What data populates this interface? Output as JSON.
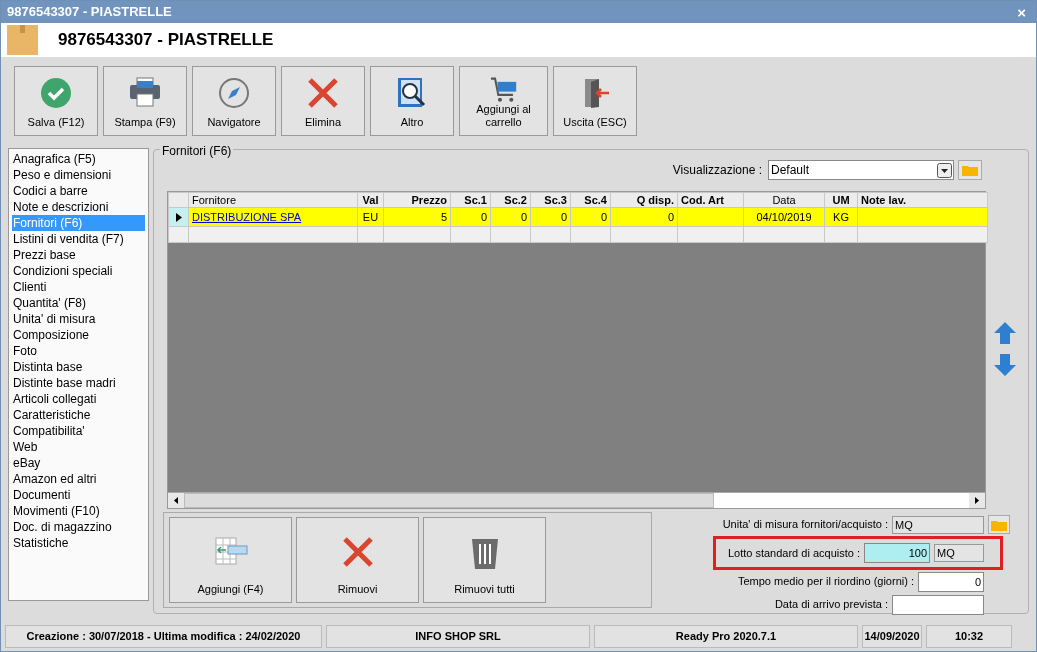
{
  "window": {
    "title": "9876543307 - PIASTRELLE",
    "close": "×"
  },
  "header": {
    "title": "9876543307 - PIASTRELLE"
  },
  "toolbar": [
    {
      "label": "Salva (F12)",
      "kind": "check"
    },
    {
      "label": "Stampa (F9)",
      "kind": "print"
    },
    {
      "label": "Navigatore",
      "kind": "compass"
    },
    {
      "label": "Elimina",
      "kind": "delete"
    },
    {
      "label": "Altro",
      "kind": "search"
    },
    {
      "label": "Aggiungi al carrello",
      "kind": "cart"
    },
    {
      "label": "Uscita (ESC)",
      "kind": "exit"
    }
  ],
  "sidebar": {
    "items": [
      {
        "label": "Anagrafica (F5)",
        "selected": false
      },
      {
        "label": "Peso e dimensioni",
        "selected": false
      },
      {
        "label": "Codici a barre",
        "selected": false
      },
      {
        "label": "Note e descrizioni",
        "selected": false
      },
      {
        "label": "Fornitori (F6)",
        "selected": true
      },
      {
        "label": "Listini di vendita (F7)",
        "selected": false
      },
      {
        "label": "Prezzi base",
        "selected": false
      },
      {
        "label": "Condizioni speciali",
        "selected": false
      },
      {
        "label": "Clienti",
        "selected": false
      },
      {
        "label": "Quantita' (F8)",
        "selected": false
      },
      {
        "label": "Unita' di misura",
        "selected": false
      },
      {
        "label": "Composizione",
        "selected": false
      },
      {
        "label": "Foto",
        "selected": false
      },
      {
        "label": "Distinta base",
        "selected": false
      },
      {
        "label": "Distinte base madri",
        "selected": false
      },
      {
        "label": "Articoli collegati",
        "selected": false
      },
      {
        "label": "Caratteristiche",
        "selected": false
      },
      {
        "label": "Compatibilita'",
        "selected": false
      },
      {
        "label": "Web",
        "selected": false
      },
      {
        "label": "eBay",
        "selected": false
      },
      {
        "label": "Amazon ed altri",
        "selected": false
      },
      {
        "label": "Documenti",
        "selected": false
      },
      {
        "label": "Movimenti (F10)",
        "selected": false
      },
      {
        "label": "Doc. di magazzino",
        "selected": false
      },
      {
        "label": "Statistiche",
        "selected": false
      }
    ]
  },
  "panel": {
    "title": "Fornitori (F6)",
    "view_label": "Visualizzazione :",
    "view_value": "Default"
  },
  "table": {
    "columns": [
      "Fornitore",
      "Val",
      "Prezzo",
      "Sc.1",
      "Sc.2",
      "Sc.3",
      "Sc.4",
      "Q disp.",
      "Cod. Art",
      "Data",
      "UM",
      "Note lav."
    ],
    "rows": [
      {
        "selected": true,
        "cells": [
          "DISTRIBUZIONE SPA",
          "EU",
          "5",
          "0",
          "0",
          "0",
          "0",
          "0",
          "",
          "04/10/2019",
          "KG",
          ""
        ]
      }
    ]
  },
  "actions": [
    {
      "label": "Aggiungi (F4)",
      "kind": "add"
    },
    {
      "label": "Rimuovi",
      "kind": "delete"
    },
    {
      "label": "Rimuovi tutti",
      "kind": "trash"
    }
  ],
  "fields": [
    {
      "label": "Unita' di misura fornitori/acquisto :",
      "value": "MQ",
      "kind": "picker"
    },
    {
      "label": "Lotto standard di acquisto :",
      "value": "100",
      "unit": "MQ",
      "kind": "number",
      "highlighted": true
    },
    {
      "label": "Tempo medio per il riordino (giorni) :",
      "value": "0",
      "kind": "number",
      "highlighted": false
    },
    {
      "label": "Data di arrivo prevista :",
      "kind": "text"
    }
  ],
  "status_bar": [
    "Creazione : 30/07/2018 - Ultima modifica : 24/02/2020",
    "INFO SHOP SRL",
    "Ready Pro 2020.7.1",
    "14/09/2020",
    "10:32"
  ]
}
